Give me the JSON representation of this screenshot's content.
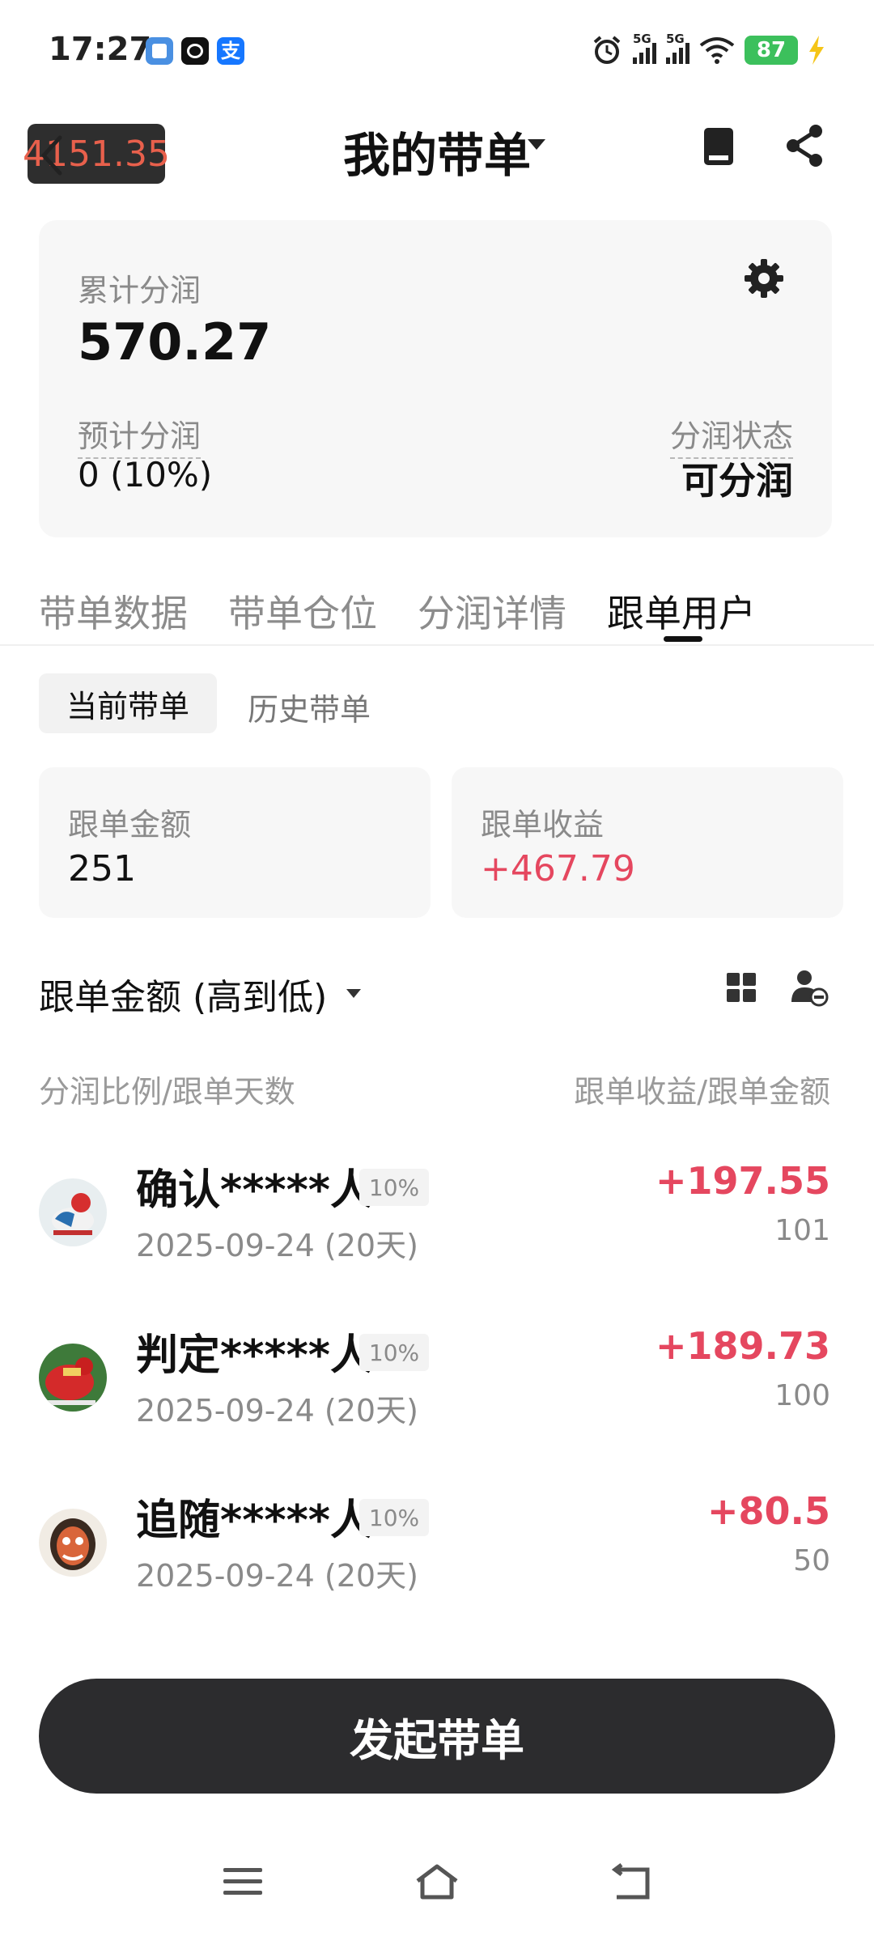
{
  "status_bar": {
    "time": "17:27",
    "network_1": "5G",
    "network_2": "5G",
    "battery": "87",
    "icons": [
      "notes-app-icon",
      "qq-app-icon",
      "alipay-app-icon",
      "alarm-icon",
      "signal-icon",
      "wifi-icon",
      "battery-icon",
      "charging-icon"
    ]
  },
  "header": {
    "balance_overlay": "4151.35",
    "title": "我的带单",
    "icons": [
      "back-icon",
      "title-caret-icon",
      "book-icon",
      "share-icon"
    ]
  },
  "summary": {
    "cumulative_label": "累计分润",
    "cumulative_value": "570.27",
    "estimated_label": "预计分润",
    "estimated_value": "0 (10%)",
    "status_label": "分润状态",
    "status_value": "可分润"
  },
  "tabs": [
    {
      "label": "带单数据",
      "active": false
    },
    {
      "label": "带单仓位",
      "active": false
    },
    {
      "label": "分润详情",
      "active": false
    },
    {
      "label": "跟单用户",
      "active": true
    }
  ],
  "segments": {
    "current": "当前带单",
    "history": "历史带单"
  },
  "stats": {
    "amount_label": "跟单金额",
    "amount_value": "251",
    "profit_label": "跟单收益",
    "profit_value": "+467.79"
  },
  "sort": {
    "label": "跟单金额 (高到低)"
  },
  "columns": {
    "left": "分润比例/跟单天数",
    "right": "跟单收益/跟单金额"
  },
  "followers": [
    {
      "name": "确认*****人",
      "ratio": "10%",
      "date": "2025-09-24 (20天)",
      "profit": "+197.55",
      "amount": "101"
    },
    {
      "name": "判定*****人",
      "ratio": "10%",
      "date": "2025-09-24 (20天)",
      "profit": "+189.73",
      "amount": "100"
    },
    {
      "name": "追随*****人",
      "ratio": "10%",
      "date": "2025-09-24 (20天)",
      "profit": "+80.5",
      "amount": "50"
    }
  ],
  "cta": {
    "label": "发起带单"
  },
  "colors": {
    "positive": "#e5475f",
    "battery": "#3cc05c",
    "cta_bg": "#2c2c2e"
  }
}
